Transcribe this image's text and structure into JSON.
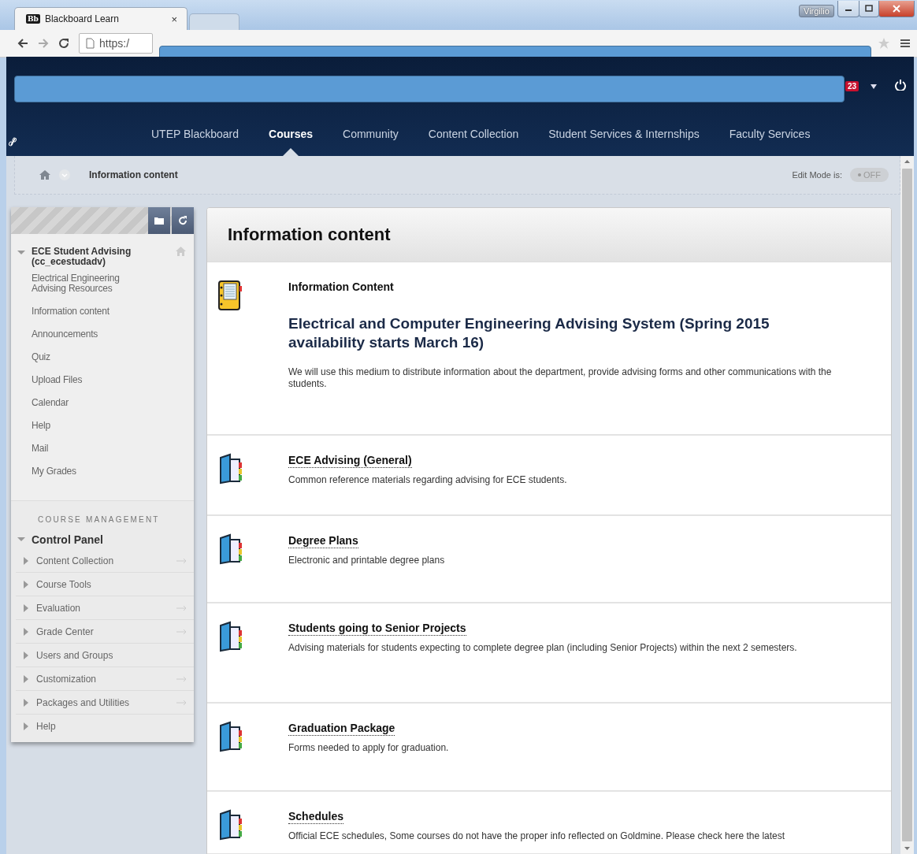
{
  "browser": {
    "tabs": [
      {
        "logo": "Bb",
        "label": "Blackboard Learn",
        "close": "×",
        "selected": true
      },
      {
        "selected": false
      }
    ],
    "user": "Virgilio",
    "address": "https:/"
  },
  "header": {
    "notifications": "23",
    "nav": [
      {
        "label": "UTEP Blackboard",
        "selected": false
      },
      {
        "label": "Courses",
        "selected": true
      },
      {
        "label": "Community",
        "selected": false
      },
      {
        "label": "Content Collection",
        "selected": false
      },
      {
        "label": "Student Services & Internships",
        "selected": false
      },
      {
        "label": "Faculty Services",
        "selected": false
      }
    ]
  },
  "breadcrumb": {
    "title": "Information content",
    "edit_mode": {
      "label": "Edit Mode is:",
      "state": "OFF",
      "on": false
    }
  },
  "sidebar": {
    "course": {
      "title": "ECE Student Advising (cc_ecestudadv)",
      "expanded": true,
      "items": [
        "Electrical Engineering Advising Resources",
        "Information content",
        "Announcements",
        "Quiz",
        "Upload Files",
        "Calendar",
        "Help",
        "Mail",
        "My Grades"
      ]
    },
    "management": {
      "heading": "COURSE MANAGEMENT",
      "panel": {
        "title": "Control Panel",
        "expanded": true,
        "items": [
          {
            "label": "Content Collection",
            "expanded": false,
            "go_arrow": true
          },
          {
            "label": "Course Tools",
            "expanded": false,
            "go_arrow": false
          },
          {
            "label": "Evaluation",
            "expanded": false,
            "go_arrow": true
          },
          {
            "label": "Grade Center",
            "expanded": false,
            "go_arrow": true
          },
          {
            "label": "Users and Groups",
            "expanded": false,
            "go_arrow": false
          },
          {
            "label": "Customization",
            "expanded": false,
            "go_arrow": true
          },
          {
            "label": "Packages and Utilities",
            "expanded": false,
            "go_arrow": true
          },
          {
            "label": "Help",
            "expanded": false,
            "go_arrow": false
          }
        ]
      }
    }
  },
  "content": {
    "title": "Information content",
    "items": [
      {
        "kind": "item",
        "label": "Information Content",
        "heading": "Electrical and Computer Engineering Advising System (Spring 2015 availability starts March 16)",
        "description": "We will use this medium to distribute information about the department, provide advising forms and other communications with the students."
      },
      {
        "kind": "folder",
        "label": "ECE Advising (General)",
        "description": "Common reference materials regarding advising for ECE students."
      },
      {
        "kind": "folder",
        "label": "Degree Plans",
        "description": "Electronic and printable degree plans"
      },
      {
        "kind": "folder",
        "label": "Students going to Senior Projects",
        "description": "Advising materials for students expecting to complete degree plan (including Senior Projects) within the next 2 semesters."
      },
      {
        "kind": "folder",
        "label": "Graduation Package",
        "description": "Forms needed to apply for graduation."
      },
      {
        "kind": "folder",
        "label": "Schedules",
        "description": "Official ECE schedules, Some courses do not have the proper info reflected on Goldmine. Please check here the latest"
      }
    ]
  }
}
